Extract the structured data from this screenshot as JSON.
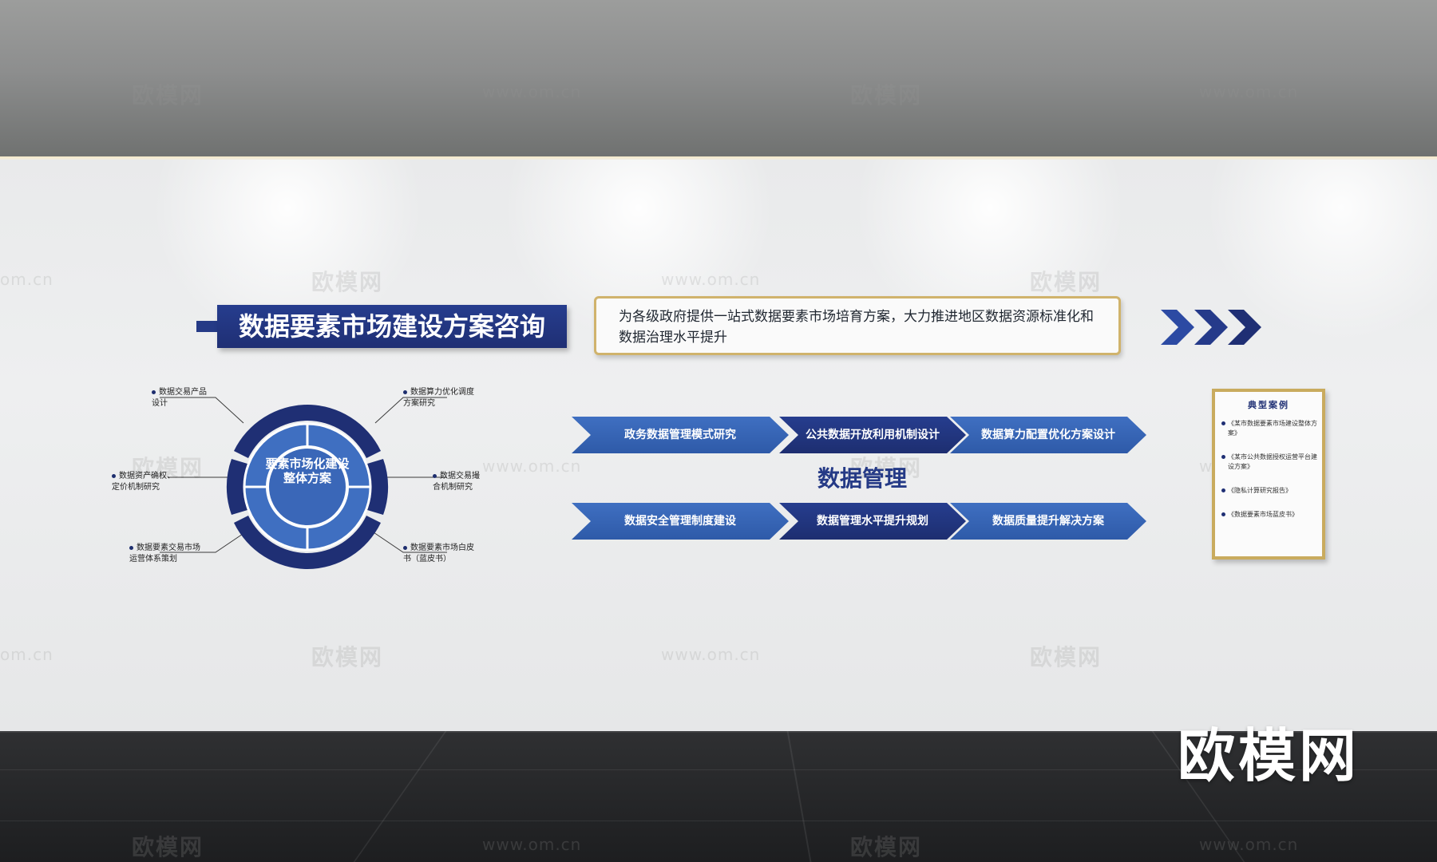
{
  "watermarks": {
    "logo": "欧模网",
    "url": "www.om.cn",
    "url_partial": "om.cn",
    "brand": "欧模网"
  },
  "title": "数据要素市场建设方案咨询",
  "description": "为各级政府提供一站式数据要素市场培育方案，大力推进地区数据资源标准化和数据治理水平提升",
  "circle": {
    "center_label": "要素市场化建设整体方案",
    "items": [
      "数据交易产品设计",
      "数据资产确权、定价机制研究",
      "数据要素交易市场运营体系策划",
      "数据算力优化调度方案研究",
      "数据交易撮合机制研究",
      "数据要素市场白皮书（蓝皮书）"
    ]
  },
  "process": {
    "title": "数据管理",
    "row1": [
      "政务数据管理模式研究",
      "公共数据开放利用机制设计",
      "数据算力配置优化方案设计"
    ],
    "row2": [
      "数据安全管理制度建设",
      "数据管理水平提升规划",
      "数据质量提升解决方案"
    ]
  },
  "cases": {
    "title": "典型案例",
    "items": [
      "《某市数据要素市场建设整体方案》",
      "《某市公共数据授权运营平台建设方案》",
      "《隐私计算研究报告》",
      "《数据要素市场蓝皮书》"
    ]
  },
  "colors": {
    "navy": "#253a86",
    "blue": "#3a67b8",
    "gold": "#c9ab5e"
  }
}
